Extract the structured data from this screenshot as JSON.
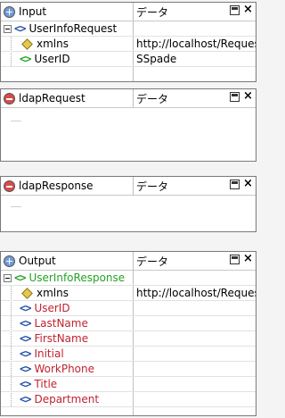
{
  "panels": {
    "input": {
      "title": "Input",
      "col2": "データ",
      "rows": [
        {
          "name": "UserInfoRequest",
          "value": ""
        },
        {
          "name": "xmlns",
          "value": "http://localhost/RequestU"
        },
        {
          "name": "UserID",
          "value": "SSpade"
        }
      ]
    },
    "ldap_request": {
      "title": "ldapRequest",
      "col2": "データ"
    },
    "ldap_response": {
      "title": "ldapResponse",
      "col2": "データ"
    },
    "output": {
      "title": "Output",
      "col2": "データ",
      "rows": [
        {
          "name": "UserInfoResponse",
          "value": ""
        },
        {
          "name": "xmlns",
          "value": "http://localhost/RequestU"
        },
        {
          "name": "UserID",
          "value": ""
        },
        {
          "name": "LastName",
          "value": ""
        },
        {
          "name": "FirstName",
          "value": ""
        },
        {
          "name": "Initial",
          "value": ""
        },
        {
          "name": "WorkPhone",
          "value": ""
        },
        {
          "name": "Title",
          "value": ""
        },
        {
          "name": "Department",
          "value": ""
        }
      ]
    }
  },
  "icons": {
    "expand": "plus-circle-icon",
    "collapse": "minus-circle-icon",
    "element": "element-brackets-icon",
    "attribute": "attribute-diamond-icon",
    "minimize": "minimize-icon",
    "close": "close-icon"
  },
  "colors": {
    "element_icon_blue": "#1f4fa8",
    "element_green": "#23a323",
    "field_red": "#c0232f",
    "attribute_yellow": "#e6c94a"
  }
}
